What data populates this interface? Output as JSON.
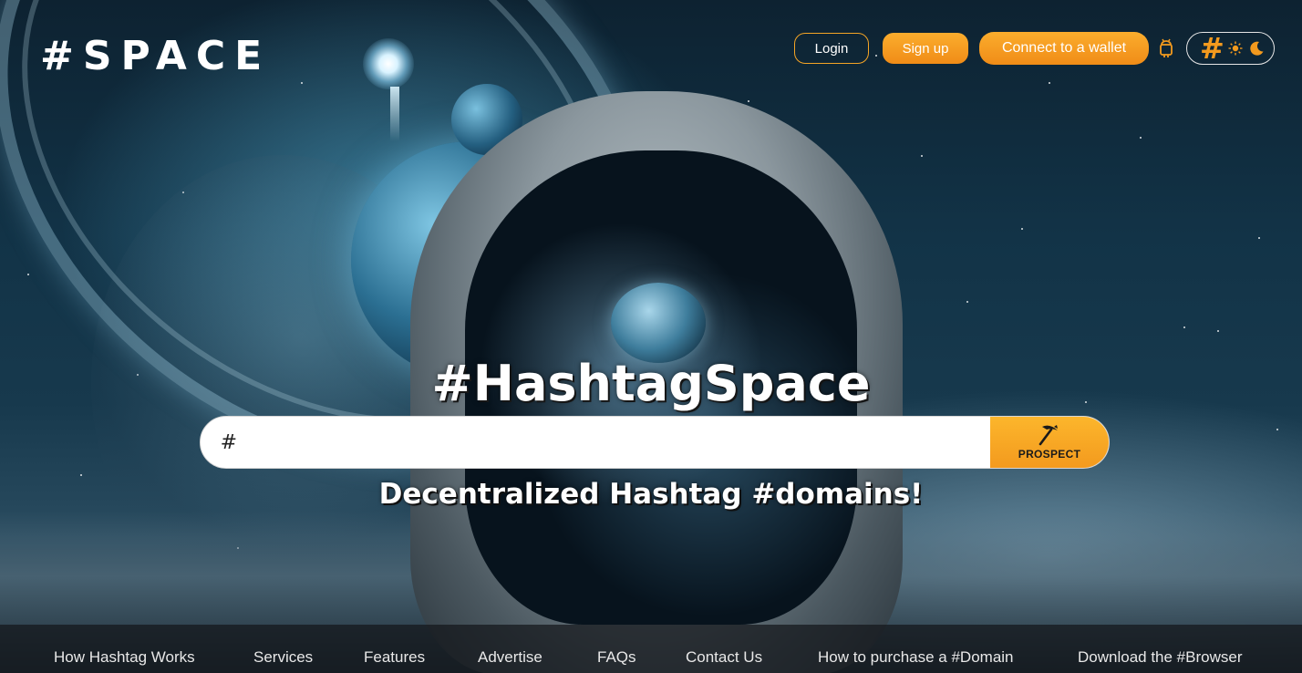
{
  "brand": {
    "logo_text": "#SPACE"
  },
  "header": {
    "login_label": "Login",
    "signup_label": "Sign up",
    "wallet_label": "Connect to a wallet",
    "theme_hash": "#"
  },
  "hero": {
    "title": "#HashtagSpace",
    "search_prefix": "#",
    "search_placeholder": "",
    "search_value": "",
    "prospect_label": "PROSPECT",
    "subtitle": "Decentralized Hashtag #domains!"
  },
  "footer_nav": [
    {
      "label": "How Hashtag Works"
    },
    {
      "label": "Services"
    },
    {
      "label": "Features"
    },
    {
      "label": "Advertise"
    },
    {
      "label": "FAQs"
    },
    {
      "label": "Contact Us"
    },
    {
      "label": "How to purchase a #Domain"
    },
    {
      "label": "Download the #Browser"
    }
  ],
  "colors": {
    "accent": "#f39a1e",
    "accent_light": "#fcb62c",
    "text_light": "#ffffff"
  },
  "icons": {
    "android": "android-icon",
    "sun": "sun-icon",
    "moon": "moon-icon",
    "pickaxe": "pickaxe-icon"
  }
}
